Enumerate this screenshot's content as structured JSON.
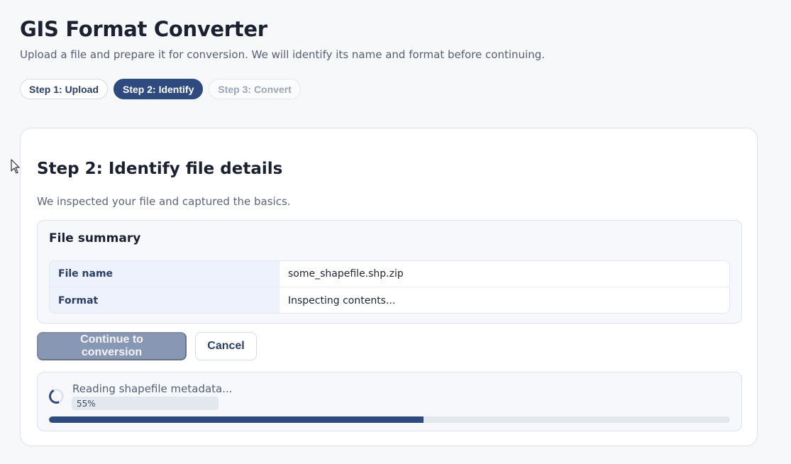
{
  "header": {
    "title": "GIS Format Converter",
    "subtitle": "Upload a file and prepare it for conversion. We will identify its name and format before continuing."
  },
  "steps": [
    {
      "label": "Step 1: Upload",
      "state": "complete"
    },
    {
      "label": "Step 2: Identify",
      "state": "active"
    },
    {
      "label": "Step 3: Convert",
      "state": "disabled"
    }
  ],
  "card": {
    "title": "Step 2: Identify file details",
    "description": "We inspected your file and captured the basics.",
    "summary": {
      "title": "File summary",
      "rows": [
        {
          "label": "File name",
          "value": "some_shapefile.shp.zip"
        },
        {
          "label": "Format",
          "value": "Inspecting contents..."
        }
      ]
    },
    "actions": {
      "primary_label": "Continue to conversion",
      "primary_disabled": true,
      "secondary_label": "Cancel"
    },
    "progress": {
      "label": "Reading shapefile metadata...",
      "percent_label": "55%",
      "fraction": 0.55
    }
  },
  "colors": {
    "accent": "#2f4a7f",
    "disabled_button": "#8797b4",
    "track": "#e3e8ef"
  },
  "icons": {
    "spinner": "loading-spinner-icon",
    "cursor": "mouse-pointer-icon"
  }
}
